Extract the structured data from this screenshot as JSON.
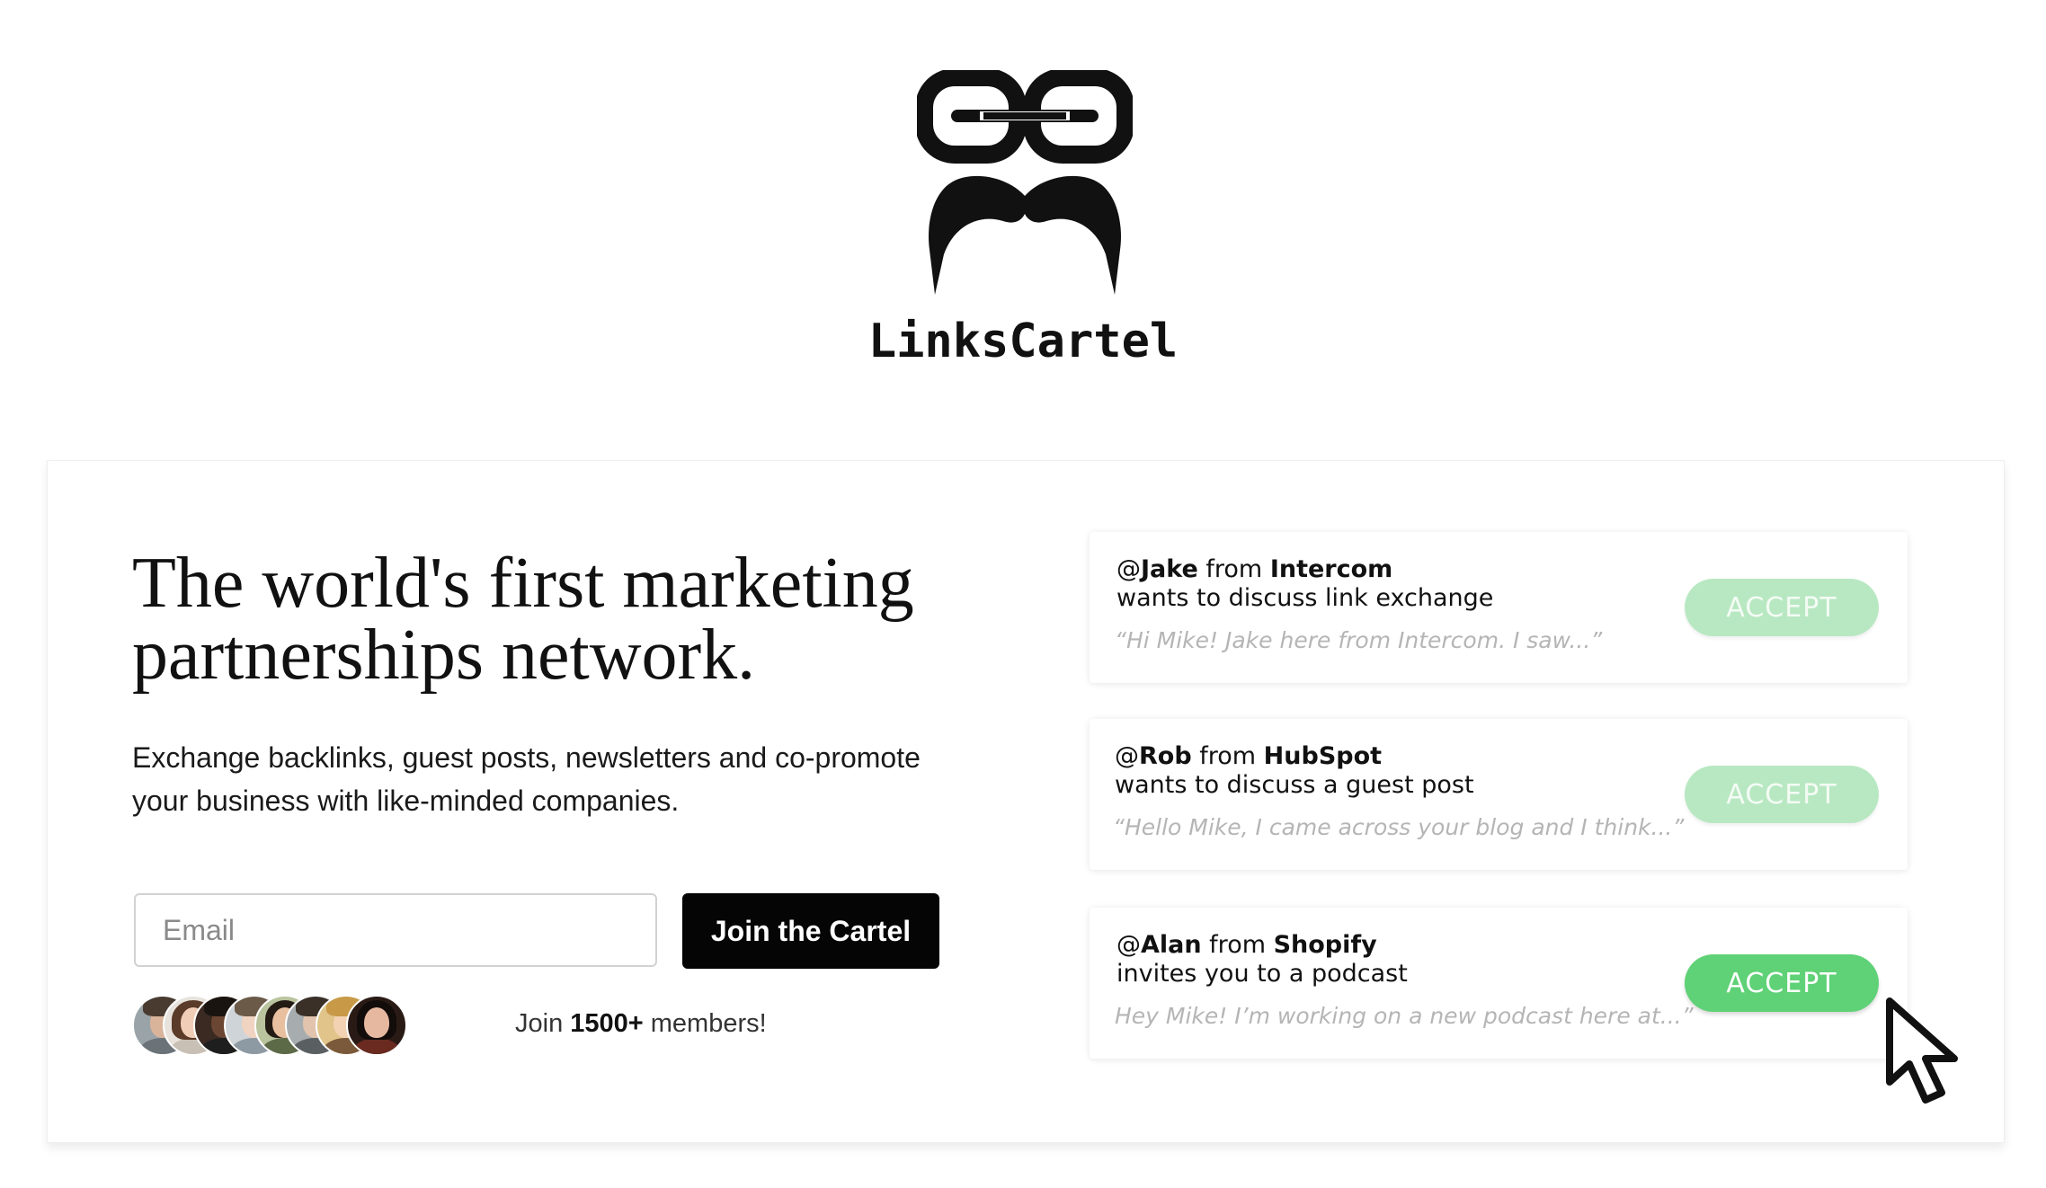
{
  "brand": {
    "name": "LinksCartel"
  },
  "hero": {
    "headline_line1": "The world's first marketing",
    "headline_line2": "partnerships network.",
    "subtext_line1": "Exchange backlinks, guest posts, newsletters and co-promote",
    "subtext_line2": "your business with like-minded companies."
  },
  "signup": {
    "email_placeholder": "Email",
    "email_value": "",
    "button_label": "Join the Cartel"
  },
  "members": {
    "prefix": "Join ",
    "count": "1500+",
    "suffix": " members!"
  },
  "notifications": [
    {
      "at": "@",
      "user": "Jake",
      "from": " from ",
      "company": "Intercom",
      "action": "wants to discuss link exchange",
      "quote": "“Hi Mike! Jake here from Intercom. I saw...”",
      "button": "ACCEPT",
      "state": "faded"
    },
    {
      "at": "@",
      "user": "Rob",
      "from": " from ",
      "company": "HubSpot",
      "action": "wants to discuss a guest post",
      "quote": "“Hello Mike, I came across your blog and I think...”",
      "button": "ACCEPT",
      "state": "faded"
    },
    {
      "at": "@",
      "user": "Alan",
      "from": " from ",
      "company": "Shopify",
      "action": "invites you to a podcast",
      "quote": "Hey Mike! I’m working on a new podcast here at...”",
      "button": "ACCEPT",
      "state": "active"
    }
  ],
  "colors": {
    "accept_active": "#5fd176",
    "accept_faded": "#b8e8c2",
    "button_dark": "#050505"
  },
  "icons": [
    "chain-link-icon",
    "mustache-icon",
    "mouse-cursor-icon"
  ]
}
